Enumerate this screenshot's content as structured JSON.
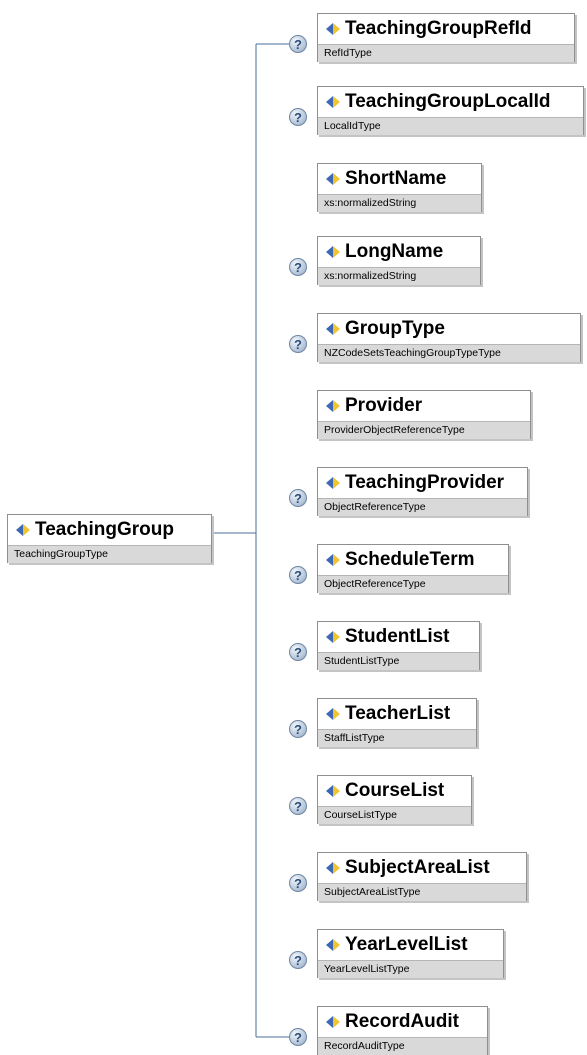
{
  "root": {
    "name": "TeachingGroup",
    "type": "TeachingGroupType"
  },
  "help_glyph": "?",
  "children": [
    {
      "name": "TeachingGroupRefId",
      "type": "RefIdType",
      "optional": true
    },
    {
      "name": "TeachingGroupLocalId",
      "type": "LocalIdType",
      "optional": true
    },
    {
      "name": "ShortName",
      "type": "xs:normalizedString",
      "optional": false
    },
    {
      "name": "LongName",
      "type": "xs:normalizedString",
      "optional": true
    },
    {
      "name": "GroupType",
      "type": "NZCodeSetsTeachingGroupTypeType",
      "optional": true
    },
    {
      "name": "Provider",
      "type": "ProviderObjectReferenceType",
      "optional": false
    },
    {
      "name": "TeachingProvider",
      "type": "ObjectReferenceType",
      "optional": true
    },
    {
      "name": "ScheduleTerm",
      "type": "ObjectReferenceType",
      "optional": true
    },
    {
      "name": "StudentList",
      "type": "StudentListType",
      "optional": true
    },
    {
      "name": "TeacherList",
      "type": "StaffListType",
      "optional": true
    },
    {
      "name": "CourseList",
      "type": "CourseListType",
      "optional": true
    },
    {
      "name": "SubjectAreaList",
      "type": "SubjectAreaListType",
      "optional": true
    },
    {
      "name": "YearLevelList",
      "type": "YearLevelListType",
      "optional": true
    },
    {
      "name": "RecordAudit",
      "type": "RecordAuditType",
      "optional": true
    }
  ],
  "colors": {
    "connector": "#4a6f9a",
    "icon_blue": "#3d68b5",
    "icon_yellow": "#f0c330",
    "type_bar": "#d9d9d9"
  },
  "icons": {
    "element": "element-diamond-icon",
    "help": "help-question-icon"
  }
}
